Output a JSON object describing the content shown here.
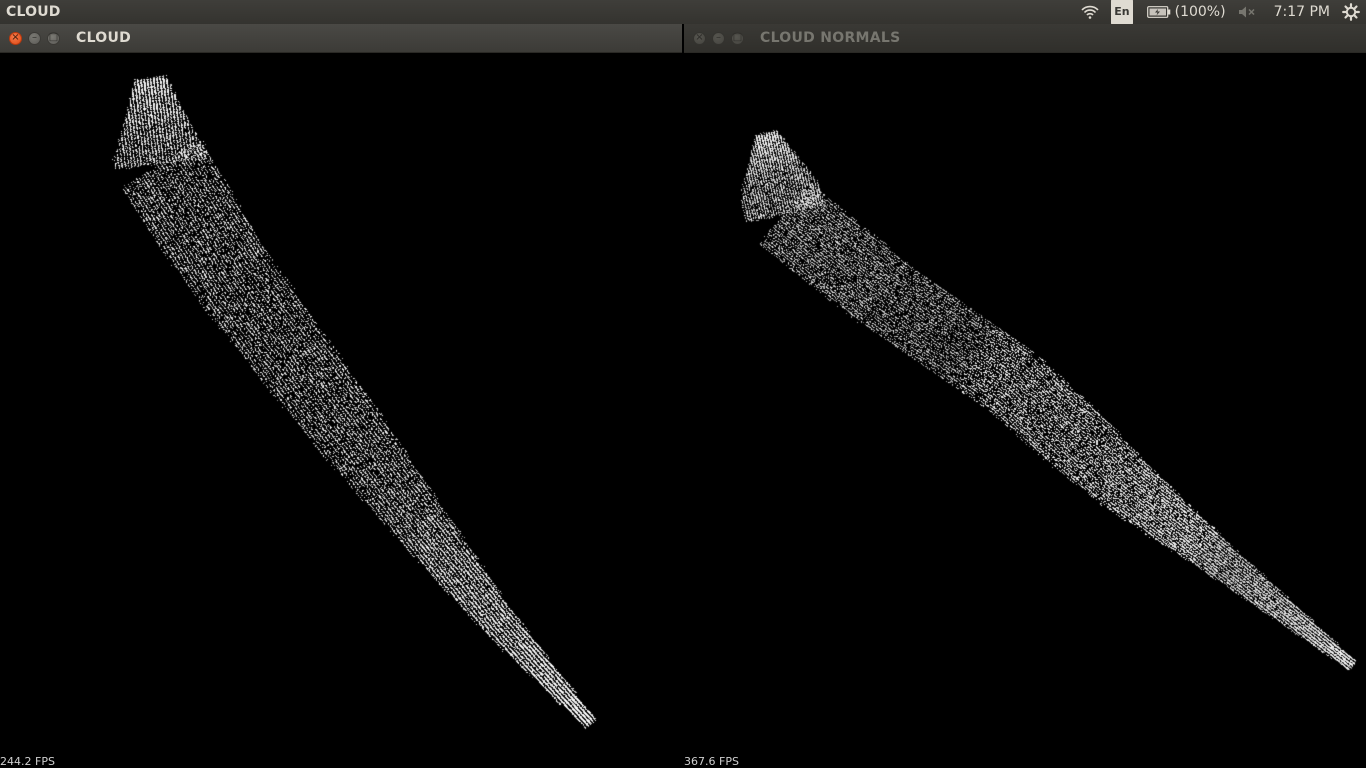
{
  "topbar": {
    "app_title": "CLOUD",
    "wifi_icon": "wifi-icon",
    "language": "En",
    "battery_icon": "battery-icon",
    "battery_text": "(100%)",
    "volume_icon": "volume-muted-icon",
    "clock": "7:17 PM",
    "settings_icon": "gear-icon"
  },
  "windows": [
    {
      "title": "CLOUD",
      "active": true,
      "fps": "244.2 FPS"
    },
    {
      "title": "CLOUD NORMALS",
      "active": false,
      "fps": "367.6 FPS"
    }
  ],
  "colors": {
    "close_button": "#df4a16",
    "panel": "#3c3b37",
    "point_cloud": "#ffffff",
    "background": "#000000"
  }
}
